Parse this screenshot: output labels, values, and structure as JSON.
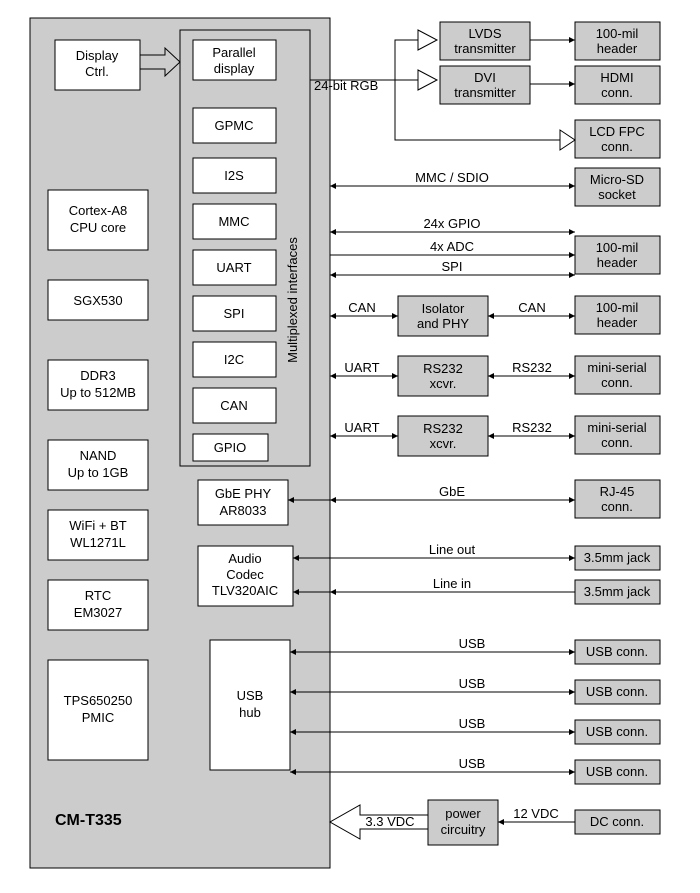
{
  "module": {
    "name": "CM-T335",
    "blocks": {
      "display_ctrl": "Display\nCtrl.",
      "cpu": "Cortex-A8\nCPU core",
      "gpu": "SGX530",
      "ddr": "DDR3\nUp to 512MB",
      "nand": "NAND\nUp to 1GB",
      "wifi": "WiFi + BT\nWL1271L",
      "rtc": "RTC\nEM3027",
      "pmic": "TPS650250\nPMIC"
    },
    "mux_label": "Multiplexed interfaces",
    "mux_items": [
      "Parallel\ndisplay",
      "GPMC",
      "I2S",
      "MMC",
      "UART",
      "SPI",
      "I2C",
      "CAN",
      "GPIO"
    ],
    "phy_blocks": {
      "gbe": "GbE PHY\nAR8033",
      "audio": "Audio\nCodec\nTLV320AIC",
      "usb_hub": "USB\nhub"
    }
  },
  "ext": {
    "lvds": "LVDS\ntransmitter",
    "dvi": "DVI\ntransmitter",
    "isolator": "Isolator\nand PHY",
    "rs232_1": "RS232\nxcvr.",
    "rs232_2": "RS232\nxcvr.",
    "power": "power\ncircuitry"
  },
  "connectors": {
    "hdr_lvds": "100-mil\nheader",
    "hdmi": "HDMI\nconn.",
    "lcd_fpc": "LCD FPC\nconn.",
    "microsd": "Micro-SD\nsocket",
    "hdr_gpio": "100-mil\nheader",
    "hdr_can": "100-mil\nheader",
    "miniser1": "mini-serial\nconn.",
    "miniser2": "mini-serial\nconn.",
    "rj45": "RJ-45\nconn.",
    "jack1": "3.5mm jack",
    "jack2": "3.5mm jack",
    "usb1": "USB conn.",
    "usb2": "USB conn.",
    "usb3": "USB conn.",
    "usb4": "USB conn.",
    "dc": "DC conn."
  },
  "labels": {
    "rgb24": "24-bit RGB",
    "mmc_sdio": "MMC / SDIO",
    "gpio24": "24x GPIO",
    "adc4": "4x ADC",
    "spi": "SPI",
    "can": "CAN",
    "uart": "UART",
    "rs232": "RS232",
    "gbe": "GbE",
    "lineout": "Line out",
    "linein": "Line in",
    "usb": "USB",
    "v33": "3.3 VDC",
    "v12": "12 VDC"
  }
}
